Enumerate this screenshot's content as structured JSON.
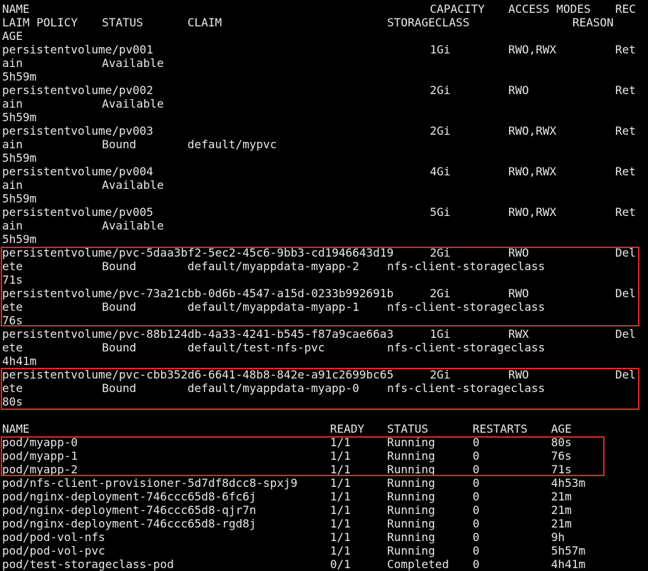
{
  "colors": {
    "background": "#000000",
    "text": "#e8e8e8",
    "highlight_border": "#e0262a"
  },
  "pv_header": {
    "line1": {
      "name": "NAME",
      "capacity": "CAPACITY",
      "access_modes": "ACCESS MODES",
      "rec": "REC"
    },
    "line2": {
      "laim_policy": "LAIM POLICY",
      "status": "STATUS",
      "claim": "CLAIM",
      "storageclass": "STORAGECLASS",
      "reason": "REASON"
    },
    "line3": {
      "age": "AGE"
    }
  },
  "pv_rows": [
    {
      "name": "persistentvolume/pv001",
      "capacity": "1Gi",
      "access": "RWO,RWX",
      "policy_start": "Ret",
      "policy_end": "ain",
      "status": "Available",
      "claim": "",
      "storageclass": "",
      "age": "5h59m"
    },
    {
      "name": "persistentvolume/pv002",
      "capacity": "2Gi",
      "access": "RWO",
      "policy_start": "Ret",
      "policy_end": "ain",
      "status": "Available",
      "claim": "",
      "storageclass": "",
      "age": "5h59m"
    },
    {
      "name": "persistentvolume/pv003",
      "capacity": "2Gi",
      "access": "RWO,RWX",
      "policy_start": "Ret",
      "policy_end": "ain",
      "status": "Bound",
      "claim": "default/mypvc",
      "storageclass": "",
      "age": "5h59m"
    },
    {
      "name": "persistentvolume/pv004",
      "capacity": "4Gi",
      "access": "RWO,RWX",
      "policy_start": "Ret",
      "policy_end": "ain",
      "status": "Available",
      "claim": "",
      "storageclass": "",
      "age": "5h59m"
    },
    {
      "name": "persistentvolume/pv005",
      "capacity": "5Gi",
      "access": "RWO,RWX",
      "policy_start": "Ret",
      "policy_end": "ain",
      "status": "Available",
      "claim": "",
      "storageclass": "",
      "age": "5h59m"
    },
    {
      "name": "persistentvolume/pvc-5daa3bf2-5ec2-45c6-9bb3-cd1946643d19",
      "capacity": "2Gi",
      "access": "RWO",
      "policy_start": "Del",
      "policy_end": "ete",
      "status": "Bound",
      "claim": "default/myappdata-myapp-2",
      "storageclass": "nfs-client-storageclass",
      "age": "71s"
    },
    {
      "name": "persistentvolume/pvc-73a21cbb-0d6b-4547-a15d-0233b992691b",
      "capacity": "2Gi",
      "access": "RWO",
      "policy_start": "Del",
      "policy_end": "ete",
      "status": "Bound",
      "claim": "default/myappdata-myapp-1",
      "storageclass": "nfs-client-storageclass",
      "age": "76s"
    },
    {
      "name": "persistentvolume/pvc-88b124db-4a33-4241-b545-f87a9cae66a3",
      "capacity": "1Gi",
      "access": "RWX",
      "policy_start": "Del",
      "policy_end": "ete",
      "status": "Bound",
      "claim": "default/test-nfs-pvc",
      "storageclass": "nfs-client-storageclass",
      "age": "4h41m"
    },
    {
      "name": "persistentvolume/pvc-cbb352d6-6641-48b8-842e-a91c2699bc65",
      "capacity": "2Gi",
      "access": "RWO",
      "policy_start": "Del",
      "policy_end": "ete",
      "status": "Bound",
      "claim": "default/myappdata-myapp-0",
      "storageclass": "nfs-client-storageclass",
      "age": "80s"
    }
  ],
  "pod_header": {
    "name": "NAME",
    "ready": "READY",
    "status": "STATUS",
    "restarts": "RESTARTS",
    "age": "AGE"
  },
  "pod_rows": [
    {
      "name": "pod/myapp-0",
      "ready": "1/1",
      "status": "Running",
      "restarts": "0",
      "age": "80s"
    },
    {
      "name": "pod/myapp-1",
      "ready": "1/1",
      "status": "Running",
      "restarts": "0",
      "age": "76s"
    },
    {
      "name": "pod/myapp-2",
      "ready": "1/1",
      "status": "Running",
      "restarts": "0",
      "age": "71s"
    },
    {
      "name": "pod/nfs-client-provisioner-5d7df8dcc8-spxj9",
      "ready": "1/1",
      "status": "Running",
      "restarts": "0",
      "age": "4h53m"
    },
    {
      "name": "pod/nginx-deployment-746ccc65d8-6fc6j",
      "ready": "1/1",
      "status": "Running",
      "restarts": "0",
      "age": "21m"
    },
    {
      "name": "pod/nginx-deployment-746ccc65d8-qjr7n",
      "ready": "1/1",
      "status": "Running",
      "restarts": "0",
      "age": "21m"
    },
    {
      "name": "pod/nginx-deployment-746ccc65d8-rgd8j",
      "ready": "1/1",
      "status": "Running",
      "restarts": "0",
      "age": "21m"
    },
    {
      "name": "pod/pod-vol-nfs",
      "ready": "1/1",
      "status": "Running",
      "restarts": "0",
      "age": "9h"
    },
    {
      "name": "pod/pod-vol-pvc",
      "ready": "1/1",
      "status": "Running",
      "restarts": "0",
      "age": "5h57m"
    },
    {
      "name": "pod/test-storageclass-pod",
      "ready": "0/1",
      "status": "Completed",
      "restarts": "0",
      "age": "4h41m"
    }
  ]
}
